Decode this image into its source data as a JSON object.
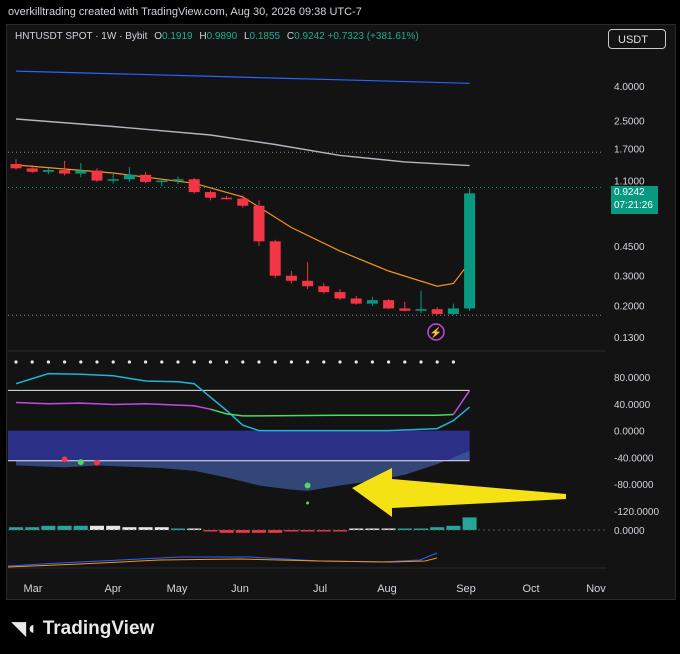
{
  "header": {
    "text": "overkilltrading created with TradingView.com, Aug 30, 2026 09:38 UTC-7"
  },
  "symbol": {
    "name": "HNTUSDT SPOT · 1W · Bybit",
    "o_label": "O",
    "o": "0.1919",
    "h_label": "H",
    "h": "0.9890",
    "l_label": "L",
    "l": "0.1855",
    "c_label": "C",
    "c": "0.9242",
    "change": "+0.7323 (+381.61%)"
  },
  "currency_button": "USDT",
  "price_badge": {
    "price": "0.9242",
    "countdown": "07:21:26"
  },
  "logo": {
    "text": "TradingView"
  },
  "colors": {
    "up": "#089981",
    "down": "#f23645",
    "ma_white": "#b2b5be",
    "ma_blue": "#2962ff",
    "ma_orange": "#f7931a",
    "osc_cyan": "#1fb4d8",
    "osc_magenta": "#c549e6",
    "osc_green": "#4cd964",
    "band_navy": "#2b2f86",
    "arrow": "#f5e214"
  },
  "chart_data": [
    {
      "type": "candlestick",
      "scale": "log",
      "price_ticks": [
        "4.0000",
        "2.5000",
        "1.7000",
        "1.1000",
        "0.4500",
        "0.3000",
        "0.2000",
        "0.1300"
      ],
      "time_labels": [
        "Mar",
        "Apr",
        "May",
        "Jun",
        "Jul",
        "Aug",
        "Sep",
        "Oct",
        "Nov"
      ],
      "candles": [
        {
          "o": 1.38,
          "h": 1.48,
          "l": 1.28,
          "c": 1.3
        },
        {
          "o": 1.3,
          "h": 1.36,
          "l": 1.22,
          "c": 1.24
        },
        {
          "o": 1.24,
          "h": 1.3,
          "l": 1.2,
          "c": 1.27
        },
        {
          "o": 1.27,
          "h": 1.44,
          "l": 1.18,
          "c": 1.21
        },
        {
          "o": 1.21,
          "h": 1.4,
          "l": 1.15,
          "c": 1.26
        },
        {
          "o": 1.26,
          "h": 1.3,
          "l": 1.08,
          "c": 1.1
        },
        {
          "o": 1.1,
          "h": 1.22,
          "l": 1.06,
          "c": 1.12
        },
        {
          "o": 1.12,
          "h": 1.32,
          "l": 1.08,
          "c": 1.19
        },
        {
          "o": 1.19,
          "h": 1.24,
          "l": 1.06,
          "c": 1.08
        },
        {
          "o": 1.08,
          "h": 1.12,
          "l": 1.02,
          "c": 1.1
        },
        {
          "o": 1.1,
          "h": 1.16,
          "l": 1.05,
          "c": 1.12
        },
        {
          "o": 1.12,
          "h": 1.14,
          "l": 0.92,
          "c": 0.94
        },
        {
          "o": 0.94,
          "h": 0.96,
          "l": 0.84,
          "c": 0.87
        },
        {
          "o": 0.87,
          "h": 0.89,
          "l": 0.85,
          "c": 0.86
        },
        {
          "o": 0.86,
          "h": 0.9,
          "l": 0.76,
          "c": 0.78
        },
        {
          "o": 0.78,
          "h": 0.84,
          "l": 0.45,
          "c": 0.48
        },
        {
          "o": 0.48,
          "h": 0.49,
          "l": 0.29,
          "c": 0.3
        },
        {
          "o": 0.3,
          "h": 0.32,
          "l": 0.27,
          "c": 0.28
        },
        {
          "o": 0.28,
          "h": 0.36,
          "l": 0.25,
          "c": 0.26
        },
        {
          "o": 0.26,
          "h": 0.27,
          "l": 0.235,
          "c": 0.24
        },
        {
          "o": 0.24,
          "h": 0.25,
          "l": 0.215,
          "c": 0.22
        },
        {
          "o": 0.22,
          "h": 0.228,
          "l": 0.202,
          "c": 0.205
        },
        {
          "o": 0.205,
          "h": 0.225,
          "l": 0.198,
          "c": 0.215
        },
        {
          "o": 0.215,
          "h": 0.218,
          "l": 0.19,
          "c": 0.192
        },
        {
          "o": 0.192,
          "h": 0.21,
          "l": 0.185,
          "c": 0.186
        },
        {
          "o": 0.186,
          "h": 0.245,
          "l": 0.18,
          "c": 0.19
        },
        {
          "o": 0.19,
          "h": 0.195,
          "l": 0.176,
          "c": 0.178
        },
        {
          "o": 0.178,
          "h": 0.205,
          "l": 0.175,
          "c": 0.192
        },
        {
          "o": 0.1919,
          "h": 0.989,
          "l": 0.1855,
          "c": 0.9242
        }
      ],
      "ma_blue": [
        [
          0,
          4.9
        ],
        [
          28,
          4.15
        ]
      ],
      "ma_white": [
        [
          0,
          2.55
        ],
        [
          6,
          2.3
        ],
        [
          12,
          2.05
        ],
        [
          16,
          1.8
        ],
        [
          20,
          1.55
        ],
        [
          24,
          1.42
        ],
        [
          28,
          1.35
        ]
      ],
      "ma_orange": [
        [
          0,
          1.36
        ],
        [
          6,
          1.22
        ],
        [
          11,
          1.06
        ],
        [
          14,
          0.88
        ],
        [
          17,
          0.58
        ],
        [
          20,
          0.42
        ],
        [
          23,
          0.32
        ],
        [
          26,
          0.26
        ],
        [
          27,
          0.27
        ],
        [
          28,
          0.36
        ]
      ],
      "dotted_levels": [
        1.0,
        0.175
      ]
    },
    {
      "type": "line",
      "name": "oscillator",
      "yticks": [
        "80.0000",
        "40.0000",
        "0.0000",
        "-40.0000",
        "-80.0000",
        "-120.0000"
      ],
      "ylim": [
        -125,
        110
      ],
      "hline": 60,
      "series": [
        {
          "values": [
            [
              0,
              70
            ],
            [
              2,
              85
            ],
            [
              4,
              84
            ],
            [
              6,
              82
            ],
            [
              8,
              74
            ],
            [
              10,
              73
            ],
            [
              11,
              70
            ],
            [
              13,
              30
            ],
            [
              14,
              8
            ],
            [
              15,
              0
            ],
            [
              17,
              0
            ],
            [
              20,
              0
            ],
            [
              23,
              0
            ],
            [
              26,
              3
            ],
            [
              27,
              15
            ],
            [
              28,
              35
            ]
          ]
        },
        {
          "values": [
            [
              0,
              42
            ],
            [
              2,
              40
            ],
            [
              4,
              41
            ],
            [
              6,
              39
            ],
            [
              8,
              40
            ],
            [
              10,
              38
            ],
            [
              11,
              37
            ],
            [
              12,
              32
            ],
            [
              13,
              25
            ],
            [
              14,
              22
            ],
            [
              15,
              22
            ],
            [
              20,
              23
            ],
            [
              26,
              23
            ],
            [
              27,
              24
            ],
            [
              28,
              60
            ]
          ]
        },
        {
          "values": [
            [
              0,
              -52
            ],
            [
              3,
              -55
            ],
            [
              5,
              -52
            ],
            [
              7,
              -54
            ],
            [
              9,
              -56
            ],
            [
              11,
              -60
            ],
            [
              13,
              -70
            ],
            [
              15,
              -82
            ],
            [
              17,
              -88
            ],
            [
              18,
              -90
            ],
            [
              20,
              -82
            ],
            [
              22,
              -75
            ],
            [
              24,
              -66
            ],
            [
              26,
              -50
            ],
            [
              28,
              -30
            ]
          ]
        }
      ],
      "band": [
        0,
        -45
      ],
      "markers": [
        {
          "x": 3,
          "y": -43,
          "kind": "sell"
        },
        {
          "x": 4,
          "y": -47,
          "kind": "buy"
        },
        {
          "x": 5,
          "y": -48,
          "kind": "sell"
        },
        {
          "x": 18,
          "y": -82,
          "kind": "buy"
        }
      ]
    },
    {
      "type": "bar",
      "name": "histogram",
      "yticks": [
        "0.0000"
      ],
      "values": [
        2,
        2,
        3,
        3,
        3,
        3,
        3,
        2,
        2,
        2,
        1,
        0,
        -1,
        -2,
        -2,
        -2,
        -2,
        -1,
        -1,
        -1,
        -1,
        0,
        0,
        0,
        1,
        1,
        2,
        3,
        9
      ]
    }
  ]
}
